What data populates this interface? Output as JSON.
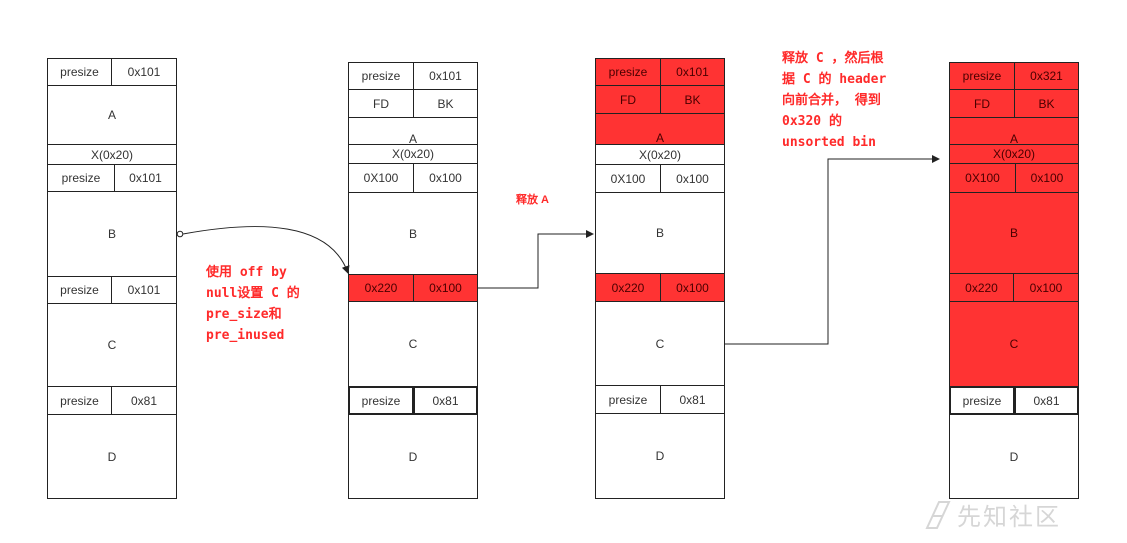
{
  "chunks": {
    "col1": {
      "presize_a": "presize",
      "size_a": "0x101",
      "label_a": "A",
      "x": "X(0x20)",
      "presize_b": "presize",
      "size_b": "0x101",
      "label_b": "B",
      "presize_c": "presize",
      "size_c": "0x101",
      "label_c": "C",
      "presize_d": "presize",
      "size_d": "0x81",
      "label_d": "D"
    },
    "col2": {
      "presize_a": "presize",
      "size_a": "0x101",
      "fd": "FD",
      "bk": "BK",
      "label_a": "A",
      "x": "X(0x20)",
      "prev_b": "0X100",
      "size_b": "0x100",
      "label_b": "B",
      "prev_c": "0x220",
      "size_c": "0x100",
      "label_c": "C",
      "presize_d": "presize",
      "size_d": "0x81",
      "label_d": "D"
    },
    "col3": {
      "presize_a": "presize",
      "size_a": "0x101",
      "fd": "FD",
      "bk": "BK",
      "label_a": "A",
      "x": "X(0x20)",
      "prev_b": "0X100",
      "size_b": "0x100",
      "label_b": "B",
      "prev_c": "0x220",
      "size_c": "0x100",
      "label_c": "C",
      "presize_d": "presize",
      "size_d": "0x81",
      "label_d": "D"
    },
    "col4": {
      "presize_a": "presize",
      "size_a": "0x321",
      "fd": "FD",
      "bk": "BK",
      "label_a": "A",
      "x": "X(0x20)",
      "prev_b": "0X100",
      "size_b": "0x100",
      "label_b": "B",
      "prev_c": "0x220",
      "size_c": "0x100",
      "label_c": "C",
      "presize_d": "presize",
      "size_d": "0x81",
      "label_d": "D"
    }
  },
  "annotations": {
    "step1": "使用 off by\nnull设置 C 的\npre_size和\npre_inused",
    "step2": "释放 A",
    "step3": "释放 C ，然后根\n据 C 的 header\n向前合并， 得到\n0x320 的\nunsorted bin"
  },
  "colors": {
    "freed": "#ff3333",
    "border": "#222222",
    "annotation": "#ff2a2a"
  },
  "watermark": {
    "text": "先知社区",
    "icon": "xianzhi-logo-icon"
  }
}
